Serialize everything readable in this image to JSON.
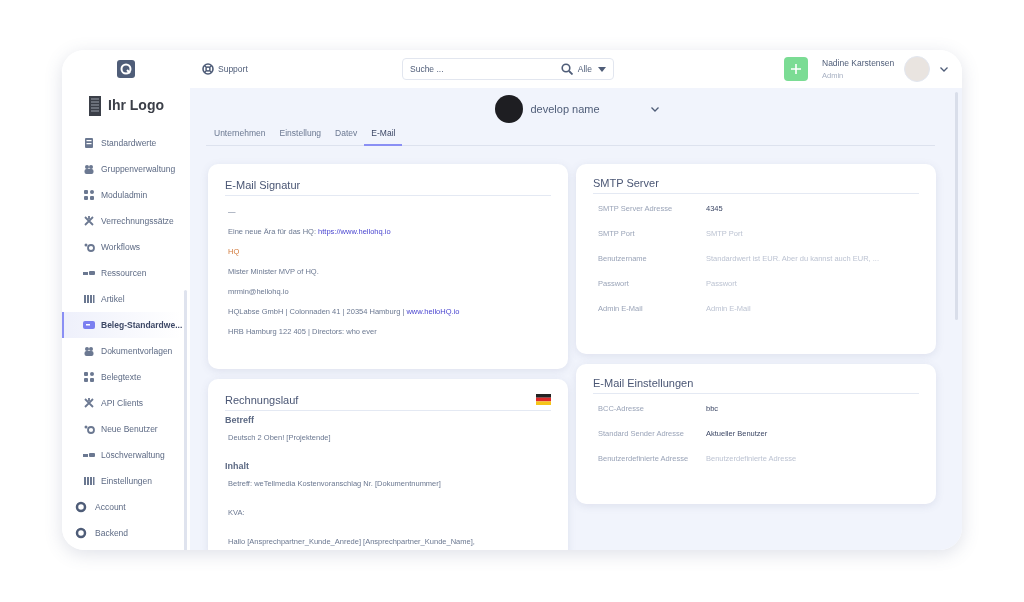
{
  "brand": {
    "logo_text": "Ihr Logo"
  },
  "sidebar": {
    "items": [
      {
        "label": "Standardwerte",
        "kind": "item",
        "selected": false
      },
      {
        "label": "Gruppenverwaltung",
        "kind": "item",
        "selected": false
      },
      {
        "label": "Moduladmin",
        "kind": "item",
        "selected": false
      },
      {
        "label": "Verrechnungssätze",
        "kind": "item",
        "selected": false
      },
      {
        "label": "Workflows",
        "kind": "item",
        "selected": false
      },
      {
        "label": "Ressourcen",
        "kind": "item",
        "selected": false
      },
      {
        "label": "Artikel",
        "kind": "item",
        "selected": false
      },
      {
        "label": "Beleg-Standardwe...",
        "kind": "item",
        "selected": true
      },
      {
        "label": "Dokumentvorlagen",
        "kind": "item",
        "selected": false
      },
      {
        "label": "Belegtexte",
        "kind": "item",
        "selected": false
      },
      {
        "label": "API Clients",
        "kind": "item",
        "selected": false
      },
      {
        "label": "Neue Benutzer",
        "kind": "item",
        "selected": false
      },
      {
        "label": "Löschverwaltung",
        "kind": "item",
        "selected": false
      },
      {
        "label": "Einstellungen",
        "kind": "item",
        "selected": false
      },
      {
        "label": "Account",
        "kind": "section",
        "selected": false
      },
      {
        "label": "Backend",
        "kind": "section",
        "selected": false
      }
    ]
  },
  "topbar": {
    "support": "Support",
    "search": {
      "placeholder": "Suche ...",
      "scope": "Alle"
    },
    "user": {
      "name": "Nadine Karstensen",
      "role": "Admin"
    }
  },
  "company": {
    "name": "develop name"
  },
  "tabs": [
    {
      "label": "Unternehmen",
      "selected": false
    },
    {
      "label": "Einstellung",
      "selected": false
    },
    {
      "label": "Datev",
      "selected": false
    },
    {
      "label": "E-Mail",
      "selected": true
    }
  ],
  "signature": {
    "title": "E-Mail Signatur",
    "lines": [
      {
        "kind": "plain",
        "text": "—"
      },
      {
        "kind": "plain",
        "text": "Eine neue Ära für das HQ: ",
        "link": "https://www.hellohq.io"
      },
      {
        "kind": "accent",
        "text": "HQ"
      },
      {
        "kind": "plain",
        "text": "Mister Minister MVP of HQ."
      },
      {
        "kind": "plain",
        "text": "mrmin@hellohq.io"
      },
      {
        "kind": "plain",
        "text": "HQLabse GmbH | Colonnaden 41 | 20354 Hamburg | ",
        "link": "www.helloHQ.io"
      },
      {
        "kind": "plain",
        "text": "HRB Hamburg 122 405 | Directors: who ever"
      }
    ]
  },
  "invoice_run": {
    "title": "Rechnungslauf",
    "subject_label": "Betreff",
    "subject": "Deutsch 2 Oben! [Projektende]",
    "content_label": "Inhalt",
    "content_lines": [
      "Betreff: weTellmedia Kostenvoranschlag Nr. [Dokumentnummer]",
      "KVA:",
      "Hallo [Ansprechpartner_Kunde_Anrede] [Ansprechpartner_Kunde_Name],"
    ]
  },
  "smtp": {
    "title": "SMTP Server",
    "fields": [
      {
        "label": "SMTP Server Adresse",
        "value": "4345"
      },
      {
        "label": "SMTP Port",
        "placeholder": "SMTP Port"
      },
      {
        "label": "Benutzername",
        "placeholder": "Standardwert ist EUR. Aber du kannst auch EUR, ..."
      },
      {
        "label": "Passwort",
        "placeholder": "Passwort"
      },
      {
        "label": "Admin E-Mail",
        "placeholder": "Admin E-Mail"
      }
    ]
  },
  "email_settings": {
    "title": "E-Mail Einstellungen",
    "fields": [
      {
        "label": "BCC-Adresse",
        "value": "bbc"
      },
      {
        "label": "Standard Sender Adresse",
        "value": "Aktueller Benutzer"
      },
      {
        "label": "Benutzerdefinierte Adresse",
        "placeholder": "Benutzerdefinierte Adresse"
      }
    ]
  }
}
